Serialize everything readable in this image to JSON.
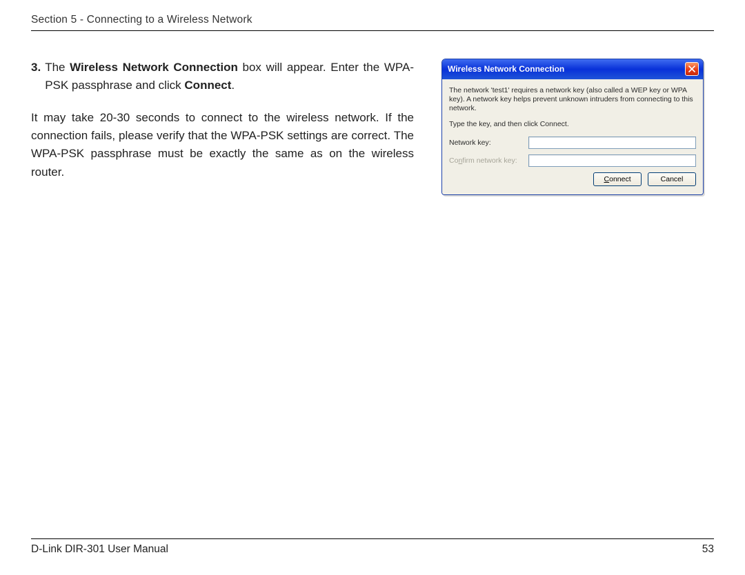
{
  "header": {
    "section": "Section 5 - Connecting to a Wireless Network"
  },
  "step": {
    "num": "3.",
    "pre": "The ",
    "bold1": "Wireless Network Connection",
    "mid": " box will appear. Enter the WPA-PSK passphrase and click ",
    "bold2": "Connect",
    "post": "."
  },
  "note": "It may take 20-30 seconds to connect to the wireless network. If the connection fails, please verify that the WPA-PSK settings are correct. The WPA-PSK passphrase must be exactly the same as on the wireless router.",
  "dialog": {
    "title": "Wireless Network Connection",
    "lead": "The network 'test1' requires a network key (also called a WEP key or WPA key). A network key helps prevent unknown intruders from connecting to this network.",
    "instruct": "Type the key, and then click Connect.",
    "label_key": "Network key:",
    "label_confirm_pre": "Co",
    "label_confirm_u": "n",
    "label_confirm_post": "firm network key:",
    "btn_connect_u": "C",
    "btn_connect_rest": "onnect",
    "btn_cancel": "Cancel"
  },
  "footer": {
    "left": "D-Link DIR-301 User Manual",
    "page": "53"
  }
}
